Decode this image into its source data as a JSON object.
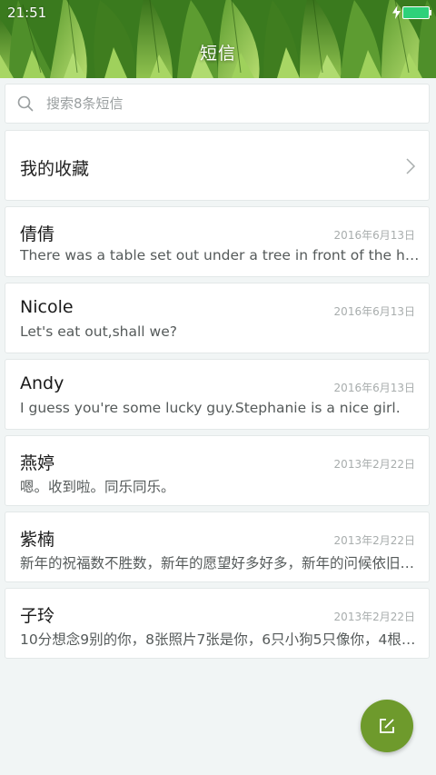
{
  "status_bar": {
    "time": "21:51",
    "charging_icon": "lightning-bolt-icon",
    "battery_icon": "battery-icon",
    "battery_color": "#2ed17a"
  },
  "header": {
    "title": "短信",
    "theme_color": "#4c8a26"
  },
  "search": {
    "icon": "search-icon",
    "placeholder": "搜索8条短信",
    "value": ""
  },
  "favorites": {
    "label": "我的收藏",
    "icon": "chevron-right-icon"
  },
  "conversations": [
    {
      "name": "倩倩",
      "date": "2016年6月13日",
      "preview": "There was a table set out under a tree in front of the hous"
    },
    {
      "name": "Nicole",
      "date": "2016年6月13日",
      "preview": "Let's eat out,shall we?"
    },
    {
      "name": "Andy",
      "date": "2016年6月13日",
      "preview": "I guess you're some lucky guy.Stephanie is a nice girl."
    },
    {
      "name": "燕婷",
      "date": "2013年2月22日",
      "preview": "嗯。收到啦。同乐同乐。"
    },
    {
      "name": "紫楠",
      "date": "2013年2月22日",
      "preview": "新年的祝福数不胜数，新年的愿望好多好多，新年的问候依旧…"
    },
    {
      "name": "子玲",
      "date": "2013年2月22日",
      "preview": "10分想念9别的你，8张照片7张是你，6只小狗5只像你，4根…"
    }
  ],
  "compose": {
    "icon": "compose-icon",
    "color": "#6e9a2c"
  }
}
